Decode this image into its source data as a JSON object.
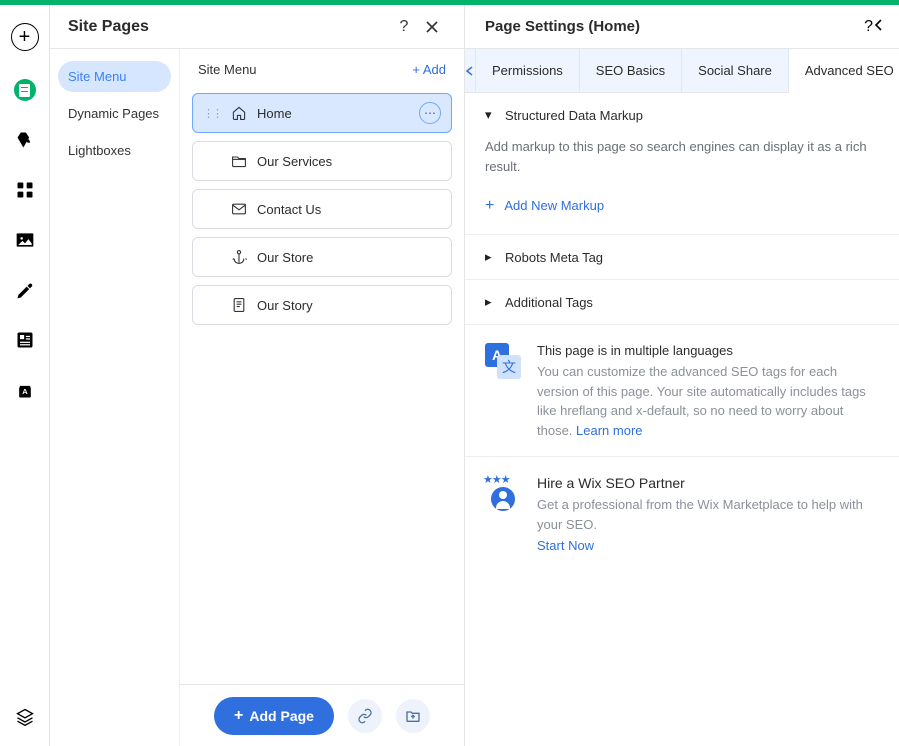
{
  "site_pages": {
    "title": "Site Pages",
    "nav": [
      "Site Menu",
      "Dynamic Pages",
      "Lightboxes"
    ],
    "active_nav": 0,
    "list_title": "Site Menu",
    "add_label": "+  Add",
    "pages": [
      {
        "name": "Home",
        "icon": "home",
        "active": true
      },
      {
        "name": "Our Services",
        "icon": "folder",
        "active": false
      },
      {
        "name": "Contact Us",
        "icon": "mail",
        "active": false
      },
      {
        "name": "Our Store",
        "icon": "anchor",
        "active": false
      },
      {
        "name": "Our Story",
        "icon": "page",
        "active": false
      }
    ],
    "add_page_btn": "Add Page"
  },
  "page_settings": {
    "title": "Page Settings (Home)",
    "tabs": [
      "Permissions",
      "SEO Basics",
      "Social Share",
      "Advanced SEO"
    ],
    "active_tab": 3,
    "sections": {
      "structured": {
        "title": "Structured Data Markup",
        "desc": "Add markup to this page so search engines can display it as a rich result.",
        "add": "Add New Markup"
      },
      "robots": {
        "title": "Robots Meta Tag"
      },
      "additional": {
        "title": "Additional Tags"
      }
    },
    "multilang": {
      "title": "This page is in multiple languages",
      "desc": "You can customize the advanced SEO tags for each version of this page. Your site automatically includes tags like hreflang and x-default, so no need to worry about those. ",
      "link": "Learn more"
    },
    "seo_partner": {
      "title": "Hire a Wix SEO Partner",
      "desc": "Get a professional from the Wix Marketplace to help with your SEO.",
      "link": "Start Now"
    }
  }
}
